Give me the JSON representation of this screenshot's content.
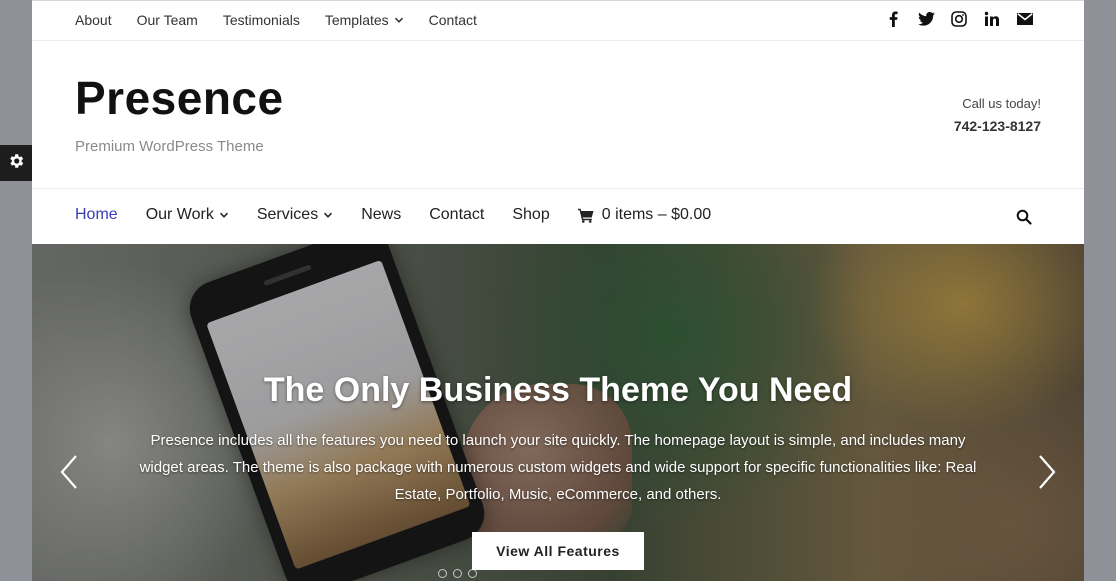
{
  "topnav": {
    "items": [
      {
        "label": "About"
      },
      {
        "label": "Our Team"
      },
      {
        "label": "Testimonials"
      },
      {
        "label": "Templates",
        "has_dropdown": true
      },
      {
        "label": "Contact"
      }
    ],
    "social_icons": [
      "facebook-icon",
      "twitter-icon",
      "instagram-icon",
      "linkedin-icon",
      "mail-icon"
    ]
  },
  "header": {
    "site_title": "Presence",
    "tagline": "Premium WordPress Theme",
    "call_label": "Call us today!",
    "phone": "742-123-8127"
  },
  "mainnav": {
    "items": [
      {
        "label": "Home",
        "active": true
      },
      {
        "label": "Our Work",
        "has_dropdown": true
      },
      {
        "label": "Services",
        "has_dropdown": true
      },
      {
        "label": "News"
      },
      {
        "label": "Contact"
      },
      {
        "label": "Shop"
      }
    ],
    "cart_label": "0 items – $0.00"
  },
  "hero": {
    "title": "The Only Business Theme You Need",
    "description": "Presence includes all the features you need to launch your site quickly. The homepage layout is simple, and includes many widget areas. The theme is also package with numerous custom widgets and wide support for specific functionalities like: Real Estate, Portfolio, Music, eCommerce, and others.",
    "button_label": "View All Features"
  },
  "colors": {
    "active_nav": "#3b3db7",
    "page_bg": "#8e9298",
    "side_tab": "#1d1d1d"
  }
}
